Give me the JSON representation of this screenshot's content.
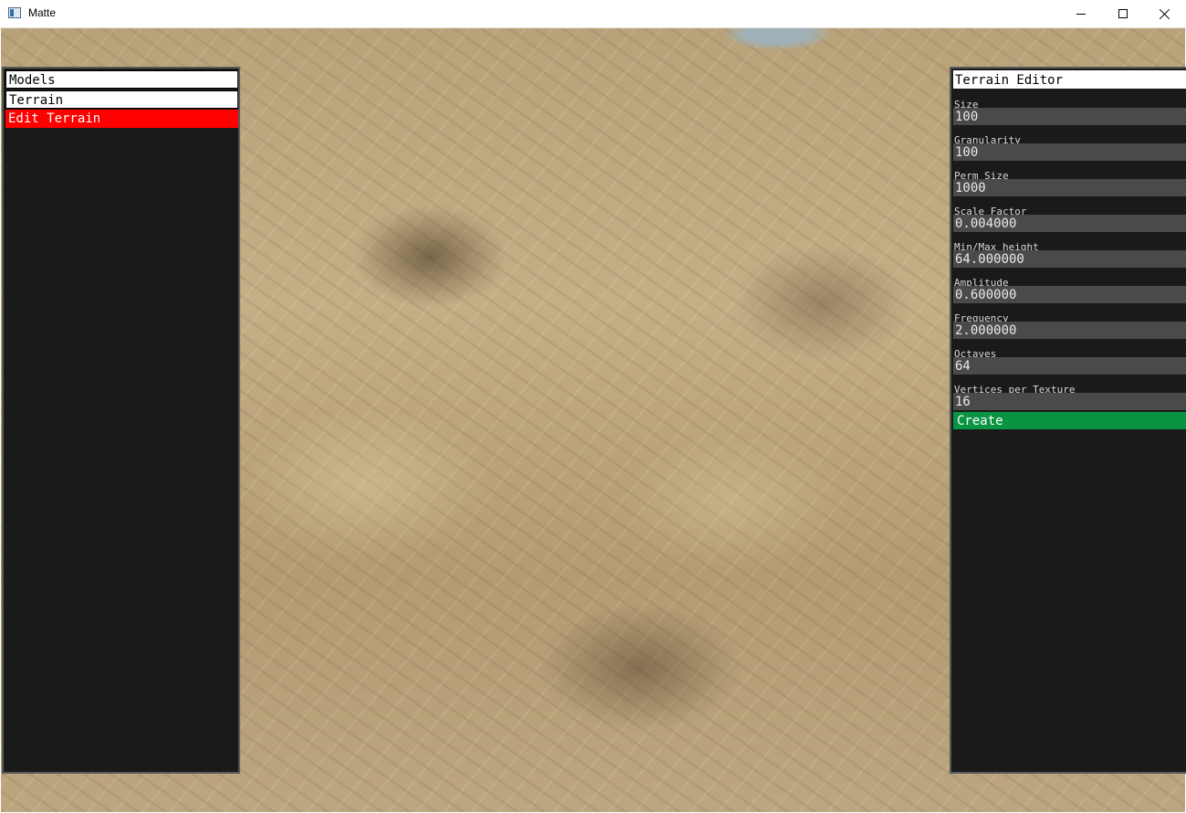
{
  "window": {
    "title": "Matte",
    "app_icon": "window-app-icon",
    "controls": [
      "minimize-icon",
      "maximize-icon",
      "close-icon"
    ]
  },
  "left_panel": {
    "header": "Models",
    "items": [
      {
        "label": "Terrain",
        "selected": false
      },
      {
        "label": "Edit Terrain",
        "selected": true
      }
    ],
    "selected_color": "#ff0000"
  },
  "terrain_editor": {
    "title": "Terrain Editor",
    "fields": [
      {
        "label": "Size",
        "value": "100"
      },
      {
        "label": "Granularity",
        "value": "100"
      },
      {
        "label": "Perm Size",
        "value": "1000"
      },
      {
        "label": "Scale Factor",
        "value": "0.004000"
      },
      {
        "label": "Min/Max height",
        "value": "64.000000"
      },
      {
        "label": "Amplitude",
        "value": "0.600000"
      },
      {
        "label": "Frequency",
        "value": "2.000000"
      },
      {
        "label": "Octaves",
        "value": "64"
      },
      {
        "label": "Vertices per Texture",
        "value": "16"
      }
    ],
    "create_label": "Create",
    "create_color": "#0a9442"
  }
}
